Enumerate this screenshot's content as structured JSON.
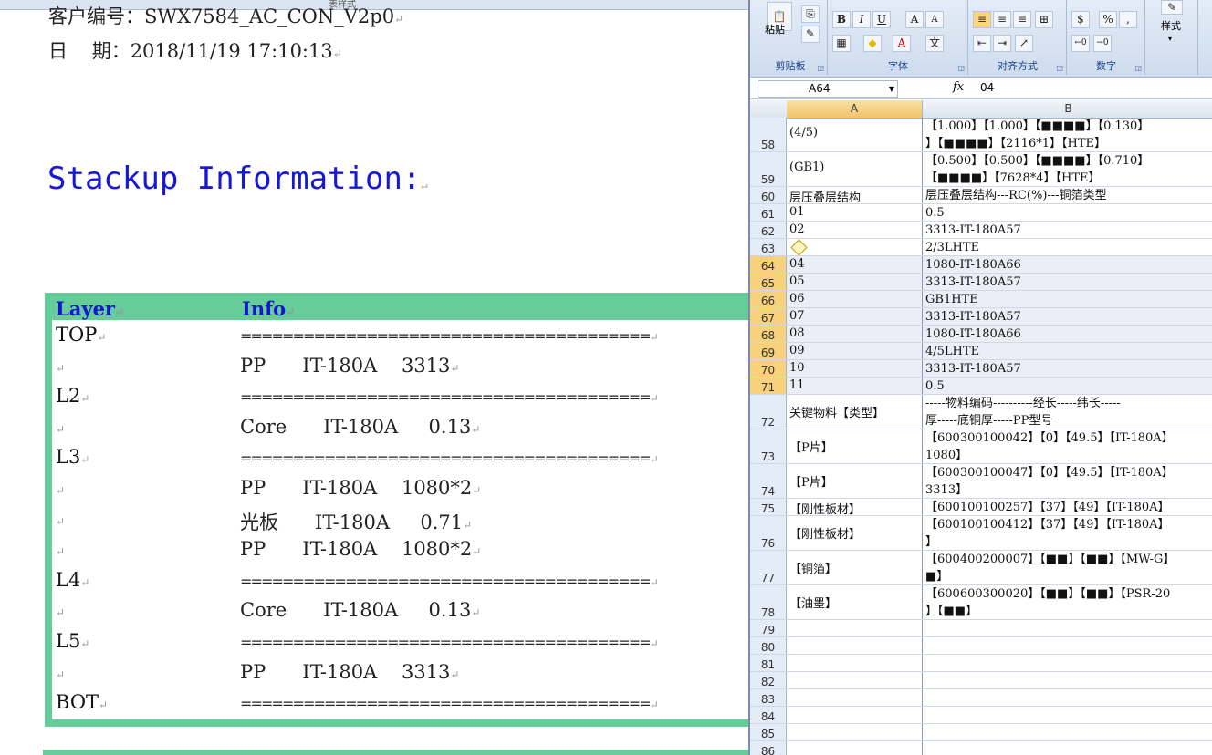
{
  "document": {
    "window_title": "表样式",
    "header_line1": "客户编号：SWX7584_AC_CON_V2p0",
    "header_line2": "日    期：2018/11/19 17:10:13",
    "stackup_title": "Stackup Information:",
    "table_headers": {
      "layer": "Layer",
      "info": "Info"
    },
    "stackup_rows": [
      {
        "layer": "TOP",
        "info": "======================================="
      },
      {
        "layer": "",
        "info": "PP      IT-180A    3313"
      },
      {
        "layer": "L2",
        "info": "======================================="
      },
      {
        "layer": "",
        "info": "Core      IT-180A     0.13"
      },
      {
        "layer": "L3",
        "info": "======================================="
      },
      {
        "layer": "",
        "info": "PP      IT-180A    1080*2"
      },
      {
        "layer": "",
        "info": "光板      IT-180A     0.71"
      },
      {
        "layer": "",
        "info": "PP      IT-180A    1080*2"
      },
      {
        "layer": "L4",
        "info": "======================================="
      },
      {
        "layer": "",
        "info": "Core      IT-180A     0.13"
      },
      {
        "layer": "L5",
        "info": "======================================="
      },
      {
        "layer": "",
        "info": "PP      IT-180A    3313"
      },
      {
        "layer": "BOT",
        "info": "======================================="
      }
    ]
  },
  "excel": {
    "ribbon_groups": [
      "剪贴板",
      "字体",
      "对齐方式",
      "数字",
      "样式"
    ],
    "paste_label": "粘贴",
    "style_label": "样式",
    "name_box": "A64",
    "fx_label": "fx",
    "formula_value": "04",
    "col_a": "A",
    "col_b": "B",
    "font_buttons": [
      "B",
      "I",
      "U",
      "A",
      "A",
      "A",
      "文"
    ],
    "number_buttons": [
      "%",
      ","
    ],
    "rows": [
      {
        "num": "58",
        "a": "(4/5)",
        "b": "【1.000】【1.000】【■■■■】【0.130】\n】【■■■■】【2116*1】【HTE】",
        "h": 38
      },
      {
        "num": "59",
        "a": "(GB1)",
        "b": "【0.500】【0.500】【■■■■】【0.710】\n【■■■■】【7628*4】【HTE】",
        "h": 38
      },
      {
        "num": "60",
        "a": "层压叠层结构",
        "b": "层压叠层结构---RC(%)---铜箔类型",
        "h": 19
      },
      {
        "num": "61",
        "a": "01",
        "b": "0.5",
        "h": 19
      },
      {
        "num": "62",
        "a": "02",
        "b": "3313-IT-180A57",
        "h": 19
      },
      {
        "num": "63",
        "a": "",
        "b": "2/3LHTE",
        "h": 19,
        "warn": true
      },
      {
        "num": "64",
        "a": "04",
        "b": "1080-IT-180A66",
        "h": 19,
        "sel": true
      },
      {
        "num": "65",
        "a": "05",
        "b": "3313-IT-180A57",
        "h": 19,
        "sel": true
      },
      {
        "num": "66",
        "a": "06",
        "b": "GB1HTE",
        "h": 19,
        "sel": true
      },
      {
        "num": "67",
        "a": "07",
        "b": "3313-IT-180A57",
        "h": 19,
        "sel": true
      },
      {
        "num": "68",
        "a": "08",
        "b": "1080-IT-180A66",
        "h": 19,
        "sel": true
      },
      {
        "num": "69",
        "a": "09",
        "b": "4/5LHTE",
        "h": 19,
        "sel": true
      },
      {
        "num": "70",
        "a": "10",
        "b": "3313-IT-180A57",
        "h": 19,
        "sel": true
      },
      {
        "num": "71",
        "a": "11",
        "b": "0.5",
        "h": 19,
        "sel": true
      },
      {
        "num": "72",
        "a": "关键物料【类型】",
        "b": "-----物料编码----------经长-----纬长-----\n厚-----底铜厚-----PP型号",
        "h": 38
      },
      {
        "num": "73",
        "a": "【P片】",
        "b": "【600300100042】【0】【49.5】【IT-180A】\n1080】",
        "h": 38
      },
      {
        "num": "74",
        "a": "【P片】",
        "b": "【600300100047】【0】【49.5】【IT-180A】\n3313】",
        "h": 38
      },
      {
        "num": "75",
        "a": "【刚性板材】",
        "b": "【600100100257】【37】【49】【IT-180A】",
        "h": 19
      },
      {
        "num": "76",
        "a": "【刚性板材】",
        "b": "【600100100412】【37】【49】【IT-180A】\n】",
        "h": 38
      },
      {
        "num": "77",
        "a": "【铜箔】",
        "b": "【600400200007】【■■】【■■】【MW-G】\n■】",
        "h": 38
      },
      {
        "num": "78",
        "a": "【油墨】",
        "b": "【600600300020】【■■】【■■】【PSR-20\n】【■■】",
        "h": 38
      },
      {
        "num": "79",
        "a": "",
        "b": "",
        "h": 19
      },
      {
        "num": "80",
        "a": "",
        "b": "",
        "h": 19
      },
      {
        "num": "81",
        "a": "",
        "b": "",
        "h": 19
      },
      {
        "num": "82",
        "a": "",
        "b": "",
        "h": 19
      },
      {
        "num": "83",
        "a": "",
        "b": "",
        "h": 19
      },
      {
        "num": "84",
        "a": "",
        "b": "",
        "h": 19
      },
      {
        "num": "85",
        "a": "",
        "b": "",
        "h": 19
      },
      {
        "num": "86",
        "a": "",
        "b": "",
        "h": 19
      }
    ]
  }
}
